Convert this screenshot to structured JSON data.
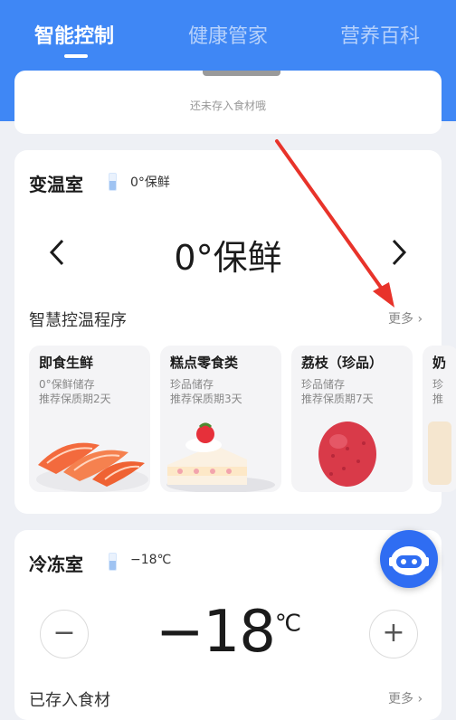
{
  "tabs": [
    {
      "label": "智能控制",
      "active": true
    },
    {
      "label": "健康管家",
      "active": false
    },
    {
      "label": "营养百科",
      "active": false
    }
  ],
  "empty_notice": "还未存入食材哦",
  "variable_room": {
    "title": "变温室",
    "mode": "0°保鲜",
    "display": "0°保鲜",
    "section_label": "智慧控温程序",
    "more_label": "更多",
    "programs": [
      {
        "title": "即食生鲜",
        "line1": "0°保鲜储存",
        "line2": "推荐保质期2天",
        "image": "salmon-image"
      },
      {
        "title": "糕点零食类",
        "line1": "珍品储存",
        "line2": "推荐保质期3天",
        "image": "cake-image"
      },
      {
        "title": "荔枝（珍品）",
        "line1": "珍品储存",
        "line2": "推荐保质期7天",
        "image": "lychee-image"
      },
      {
        "title": "奶",
        "line1": "珍",
        "line2": "推",
        "image": "milk-image"
      }
    ]
  },
  "freezer": {
    "title": "冷冻室",
    "mode": "−18℃",
    "temp_value": "−18",
    "temp_unit": "℃",
    "minus_label": "−",
    "plus_label": "+",
    "section_label": "已存入食材",
    "more_label": "更多"
  },
  "colors": {
    "accent": "#3f87f5",
    "arrow": "#e8332a",
    "robot": "#2f6df2"
  }
}
